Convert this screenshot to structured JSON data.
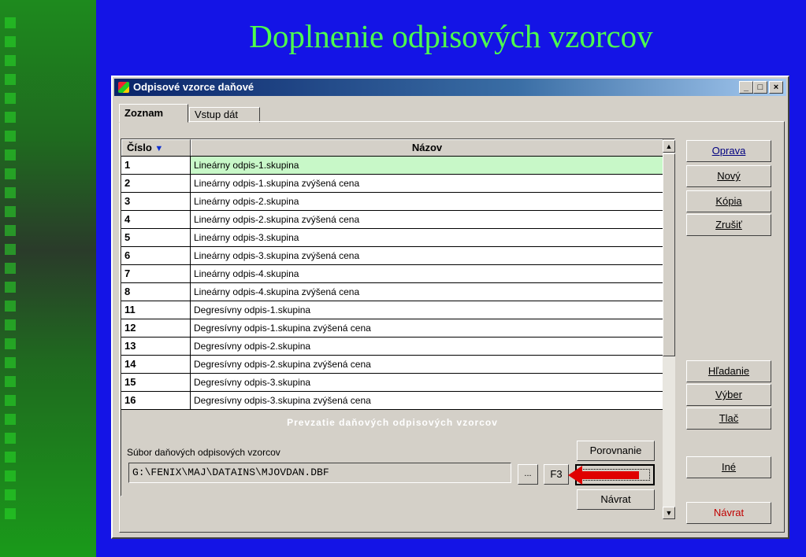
{
  "slide": {
    "title": "Doplnenie odpisových vzorcov"
  },
  "window": {
    "title": "Odpisové vzorce daňové",
    "min": "_",
    "max": "□",
    "close": "×"
  },
  "tabs": [
    {
      "label": "Zoznam"
    },
    {
      "label": "Vstup dát"
    }
  ],
  "grid": {
    "headers": {
      "cislo": "Číslo",
      "nazov": "Názov"
    },
    "rows": [
      {
        "cislo": "1",
        "nazov": "Lineárny odpis-1.skupina"
      },
      {
        "cislo": "2",
        "nazov": "Lineárny odpis-1.skupina zvýšená cena"
      },
      {
        "cislo": "3",
        "nazov": "Lineárny odpis-2.skupina"
      },
      {
        "cislo": "4",
        "nazov": "Lineárny odpis-2.skupina zvýšená cena"
      },
      {
        "cislo": "5",
        "nazov": "Lineárny odpis-3.skupina"
      },
      {
        "cislo": "6",
        "nazov": "Lineárny odpis-3.skupina zvýšená cena"
      },
      {
        "cislo": "7",
        "nazov": "Lineárny odpis-4.skupina"
      },
      {
        "cislo": "8",
        "nazov": "Lineárny odpis-4.skupina zvýšená cena"
      },
      {
        "cislo": "11",
        "nazov": "Degresívny odpis-1.skupina"
      },
      {
        "cislo": "12",
        "nazov": "Degresívny odpis-1.skupina zvýšená cena"
      },
      {
        "cislo": "13",
        "nazov": "Degresívny odpis-2.skupina"
      },
      {
        "cislo": "14",
        "nazov": "Degresívny odpis-2.skupina zvýšená cena"
      },
      {
        "cislo": "15",
        "nazov": "Degresívny odpis-3.skupina"
      },
      {
        "cislo": "16",
        "nazov": "Degresívny odpis-3.skupina zvýšená cena"
      }
    ]
  },
  "import": {
    "title": "Prevzatie daňových odpisových vzorcov",
    "file_label": "Súbor daňových odpisových vzorcov",
    "file_value": "G:\\FENIX\\MAJ\\DATAINS\\MJOVDAN.DBF",
    "browse": "...",
    "f3": "F3",
    "compare": "Porovnanie",
    "back": "Návrat"
  },
  "side_buttons": {
    "oprava": "Oprava",
    "novy": "Nový",
    "kopia": "Kópia",
    "zrusit": "Zrušiť",
    "hladanie": "Hľadanie",
    "vyber": "Výber",
    "tlac": "Tlač",
    "ine": "Iné",
    "navrat": "Návrat"
  },
  "colors": {
    "background": "#1414e6",
    "title": "#4dff4d",
    "selected_row": "#c8f8c8",
    "arrow": "#e00000",
    "navrat_text": "#c00000"
  }
}
